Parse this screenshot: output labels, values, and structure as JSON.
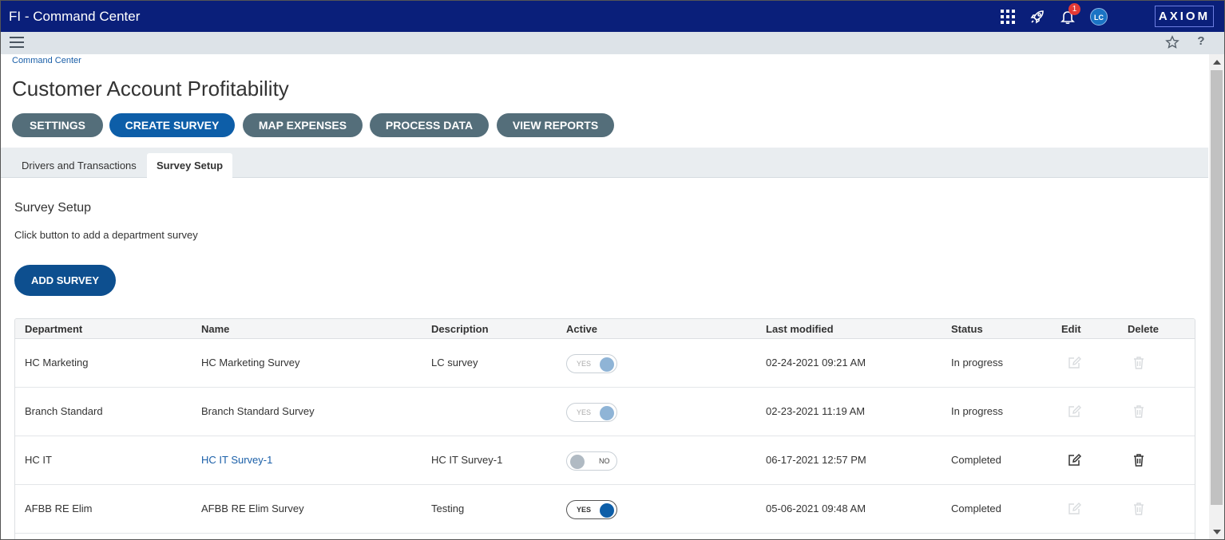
{
  "app": {
    "title": "FI - Command Center",
    "notification_count": "1",
    "avatar_initials": "LC",
    "logo_text": "AXIOM"
  },
  "icons": {
    "apps": "grid-icon",
    "launch": "rocket-icon",
    "notifications": "bell-icon",
    "menu": "hamburger-icon",
    "favorite": "star-icon",
    "help": "help-icon",
    "edit": "edit-icon",
    "delete": "trash-icon"
  },
  "colors": {
    "topbar": "#0a1f7a",
    "primary": "#0d5ea8",
    "secondary_button": "#546e7a",
    "link": "#1a5fa8"
  },
  "breadcrumb": "Command Center",
  "page_title": "Customer Account Profitability",
  "actions": [
    "SETTINGS",
    "CREATE SURVEY",
    "MAP EXPENSES",
    "PROCESS DATA",
    "VIEW REPORTS"
  ],
  "tabs": [
    "Drivers and Transactions",
    "Survey Setup"
  ],
  "section": {
    "title": "Survey Setup",
    "hint": "Click button to add a department survey",
    "add_button": "ADD SURVEY"
  },
  "table": {
    "columns": [
      "Department",
      "Name",
      "Description",
      "Active",
      "Last modified",
      "Status",
      "Edit",
      "Delete"
    ],
    "rows": [
      {
        "department": "HC Marketing",
        "name": "HC Marketing Survey",
        "description": "LC survey",
        "active": "YES",
        "modified": "02-24-2021 09:21 AM",
        "status": "In progress"
      },
      {
        "department": "Branch Standard",
        "name": "Branch Standard Survey",
        "description": "",
        "active": "YES",
        "modified": "02-23-2021 11:19 AM",
        "status": "In progress"
      },
      {
        "department": "HC IT",
        "name": "HC IT Survey-1",
        "description": "HC IT Survey-1",
        "active": "NO",
        "modified": "06-17-2021 12:57 PM",
        "status": "Completed"
      },
      {
        "department": "AFBB RE Elim",
        "name": "AFBB RE Elim Survey",
        "description": "Testing",
        "active": "YES",
        "modified": "05-06-2021 09:48 AM",
        "status": "Completed"
      }
    ]
  }
}
